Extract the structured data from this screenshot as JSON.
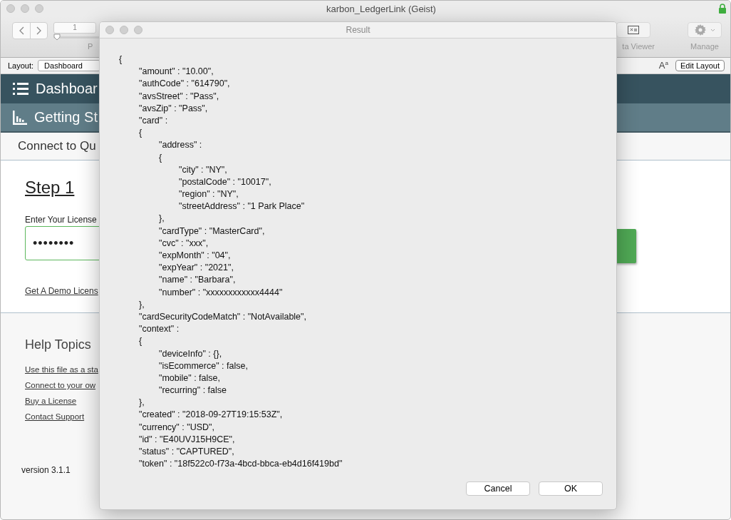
{
  "window": {
    "title": "karbon_LedgerLink (Geist)",
    "secure": true
  },
  "toolbar": {
    "record_field": "1",
    "slider_label": "P",
    "data_viewer_label": "ta Viewer",
    "manage_label": "Manage"
  },
  "layout_bar": {
    "label": "Layout:",
    "layout_value": "Dashboard",
    "text_size_button": "A$^{a}$",
    "edit_button": "Edit Layout"
  },
  "nav": [
    {
      "kind": "menu",
      "label": "Dashboar"
    },
    {
      "kind": "chart",
      "label": "Getting St"
    }
  ],
  "section_title": "Connect to Qu",
  "step": {
    "heading": "Step 1",
    "field_label": "Enter Your License",
    "field_value": "••••••••",
    "demo_link": "Get A Demo Licens"
  },
  "help": {
    "heading": "Help Topics",
    "links": [
      "Use this file as a sta",
      "Connect to your ow",
      "Buy a License",
      "Contact Support"
    ]
  },
  "version": "version 3.1.1",
  "dialog": {
    "title": "Result",
    "lines": [
      {
        "text": "{",
        "children": [
          {
            "text": "\"amount\" : \"10.00\","
          },
          {
            "text": "\"authCode\" : \"614790\","
          },
          {
            "text": "\"avsStreet\" : \"Pass\","
          },
          {
            "text": "\"avsZip\" : \"Pass\","
          },
          {
            "text": "\"card\" :"
          },
          {
            "text": "{",
            "children": [
              {
                "text": "\"address\" :"
              },
              {
                "text": "{",
                "children": [
                  {
                    "text": "\"city\" : \"NY\","
                  },
                  {
                    "text": "\"postalCode\" : \"10017\","
                  },
                  {
                    "text": "\"region\" : \"NY\","
                  },
                  {
                    "text": "\"streetAddress\" : \"1 Park Place\""
                  }
                ]
              },
              {
                "text": "},"
              },
              {
                "text": "\"cardType\" : \"MasterCard\","
              },
              {
                "text": "\"cvc\" : \"xxx\","
              },
              {
                "text": "\"expMonth\" : \"04\","
              },
              {
                "text": "\"expYear\" : \"2021\","
              },
              {
                "text": "\"name\" : \"Barbara\","
              },
              {
                "text": "\"number\" : \"xxxxxxxxxxxx4444\""
              }
            ]
          },
          {
            "text": "},"
          },
          {
            "text": "\"cardSecurityCodeMatch\" : \"NotAvailable\","
          },
          {
            "text": "\"context\" :"
          },
          {
            "text": "{",
            "children": [
              {
                "text": "\"deviceInfo\" : {},"
              },
              {
                "text": "\"isEcommerce\" : false,"
              },
              {
                "text": "\"mobile\" : false,"
              },
              {
                "text": "\"recurring\" : false"
              }
            ]
          },
          {
            "text": "},"
          },
          {
            "text": "\"created\" : \"2018-09-27T19:15:53Z\","
          },
          {
            "text": "\"currency\" : \"USD\","
          },
          {
            "text": "\"id\" : \"E40UVJ15H9CE\","
          },
          {
            "text": "\"status\" : \"CAPTURED\","
          },
          {
            "text": "\"token\" : \"18f522c0-f73a-4bcd-bbca-eb4d16f419bd\""
          }
        ]
      }
    ],
    "buttons": [
      "Cancel",
      "OK"
    ]
  }
}
